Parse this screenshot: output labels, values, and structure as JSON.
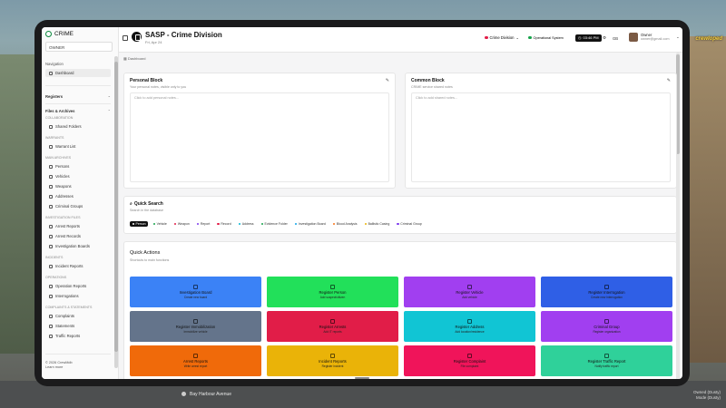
{
  "hud": {
    "top_right": "",
    "money": "crewloped",
    "street": "Bay Harbour Avenue",
    "bottom_right_1": "Owned (Dusty)",
    "bottom_right_2": "Mode (Dusty)"
  },
  "sidebar": {
    "brand": "CRIME",
    "owner_select": "OWNER",
    "navigation_label": "Navigation",
    "dashboard": "Dashboard",
    "registers_label": "Registers",
    "files_label": "Files & Archives",
    "categories": [
      {
        "name": "COLLABORATION",
        "items": [
          "Shared Folders"
        ]
      },
      {
        "name": "WARRANTS",
        "items": [
          "Warrant List"
        ]
      },
      {
        "name": "MAIN ARCHIVES",
        "items": [
          "Persons",
          "Vehicles",
          "Weapons",
          "Addresses",
          "Criminal Groups"
        ]
      },
      {
        "name": "INVESTIGATION FILES",
        "items": [
          "Arrest Reports",
          "Arrest Records",
          "Investigation Boards"
        ]
      },
      {
        "name": "INCIDENTS",
        "items": [
          "Incident Reports"
        ]
      },
      {
        "name": "OPERATIONS",
        "items": [
          "Operation Reports",
          "Interrogations"
        ]
      },
      {
        "name": "COMPLAINTS & STATEMENTS",
        "items": [
          "Complaints",
          "Statements",
          "Traffic Reports"
        ]
      }
    ],
    "footer_1": "© 2026 CrewMdb",
    "footer_2": "Learn more"
  },
  "header": {
    "title": "SASP - Crime Division",
    "subtitle": "Fri, Apr 24",
    "division": "Crime Division",
    "status": "Operational System",
    "time": "03:46 PM",
    "lang": "GB",
    "user_name": "Owner",
    "user_email": "owner@gmail.com",
    "colors": {
      "division": "#e11d48",
      "status": "#16a34a"
    }
  },
  "breadcrumb": "Dashboard",
  "personal_block": {
    "title": "Personal Block",
    "subtitle": "Your personal notes, visible only to you",
    "placeholder": "Click to add personal notes..."
  },
  "common_block": {
    "title": "Common Block",
    "subtitle": "CRIME service shared notes",
    "placeholder": "Click to add shared notes..."
  },
  "quick_search": {
    "title": "Quick Search",
    "subtitle": "Search in the database",
    "chips": [
      {
        "label": "Person",
        "color": "#ffffff",
        "selected": true
      },
      {
        "label": "Vehicle",
        "color": "#16a34a"
      },
      {
        "label": "Weapon",
        "color": "#e11d48"
      },
      {
        "label": "Report",
        "color": "#7c3aed"
      },
      {
        "label": "Record",
        "color": "#e11d48"
      },
      {
        "label": "Address",
        "color": "#06b6d4"
      },
      {
        "label": "Evidence Folder",
        "color": "#16a34a"
      },
      {
        "label": "Investigation Board",
        "color": "#0ea5e9"
      },
      {
        "label": "Blood Analysis",
        "color": "#f97316"
      },
      {
        "label": "Ballistic Casing",
        "color": "#eab308"
      },
      {
        "label": "Criminal Group",
        "color": "#7c3aed"
      }
    ]
  },
  "quick_actions": {
    "title": "Quick Actions",
    "subtitle": "Shortcuts to main functions",
    "buttons": [
      {
        "title": "Investigation Board",
        "sub": "Create new board",
        "color": "#3b82f6"
      },
      {
        "title": "Register Person",
        "sub": "Add suspect/citizen",
        "color": "#22e05a"
      },
      {
        "title": "Register Vehicle",
        "sub": "Add vehicle",
        "color": "#a13ff0"
      },
      {
        "title": "Register Interrogation",
        "sub": "Create new interrogation",
        "color": "#2f5fe6"
      },
      {
        "title": "Register Immobilization",
        "sub": "Immobilize vehicle",
        "color": "#64748b"
      },
      {
        "title": "Register Arrests",
        "sub": "Add IT reports",
        "color": "#e11d48"
      },
      {
        "title": "Register Address",
        "sub": "Add location/residence",
        "color": "#11c5d4"
      },
      {
        "title": "Criminal Group",
        "sub": "Register organization",
        "color": "#a13ff0"
      },
      {
        "title": "Arrest Reports",
        "sub": "Write arrest report",
        "color": "#f06a0a"
      },
      {
        "title": "Incident Reports",
        "sub": "Register incident",
        "color": "#eab308"
      },
      {
        "title": "Register Complaint",
        "sub": "File complaint",
        "color": "#f0145a"
      },
      {
        "title": "Register Traffic Report",
        "sub": "Notify traffic report",
        "color": "#2fd19a"
      },
      {
        "title": "",
        "sub": "",
        "color": "#6366f1"
      },
      {
        "title": "",
        "sub": "",
        "color": "#e11d48"
      },
      {
        "title": "",
        "sub": "",
        "color": "#f59e0b"
      },
      {
        "title": "",
        "sub": "",
        "color": "#64748b"
      }
    ]
  }
}
